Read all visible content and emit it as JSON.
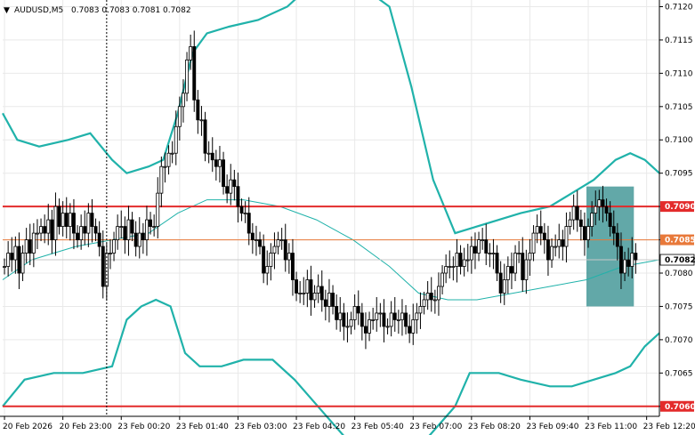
{
  "window": {
    "title": "AUDUSD,M5",
    "ohlc": "0.7083 0.7083 0.7081 0.7082",
    "collapse_glyph": "▼"
  },
  "colors": {
    "background": "#ffffff",
    "candle": "#000000",
    "bollinger_outer": "#20b2aa",
    "bollinger_middle": "#20b2aa",
    "level_main": "#e32b2b",
    "level_secondary": "#e8793a",
    "box_fill": "#2e8b8b",
    "label_bg_red": "#e32b2b",
    "label_bg_orange": "#e8793a",
    "current_label_bg": "#ffffff",
    "grid": "#e9e9e9",
    "divider": "#000000"
  },
  "chart_data": {
    "type": "candlestick",
    "symbol": "AUDUSD",
    "timeframe": "M5",
    "ylim": [
      0.70585,
      0.7121
    ],
    "y_ticks": [
      "0.7120",
      "0.7115",
      "0.7110",
      "0.7105",
      "0.7100",
      "0.7095",
      "0.7090",
      "0.7085",
      "0.7080",
      "0.7075",
      "0.7070",
      "0.7065",
      "0.7060"
    ],
    "y_tick_values": [
      0.712,
      0.7115,
      0.711,
      0.7105,
      0.71,
      0.7095,
      0.709,
      0.7085,
      0.708,
      0.7075,
      0.707,
      0.7065,
      0.706
    ],
    "x_ticks": [
      "20 Feb 2026",
      "20 Feb 23:00",
      "23 Feb 00:20",
      "23 Feb 01:40",
      "23 Feb 03:00",
      "23 Feb 04:20",
      "23 Feb 05:40",
      "23 Feb 07:00",
      "23 Feb 08:20",
      "23 Feb 09:40",
      "23 Feb 11:00",
      "23 Feb 12:20"
    ],
    "x_tick_index": [
      0,
      16,
      32,
      48,
      64,
      80,
      96,
      112,
      128,
      144,
      160,
      176
    ],
    "bar_count": 180,
    "candles_close": [
      0.7081,
      0.7083,
      0.7082,
      0.7084,
      0.708,
      0.7083,
      0.7085,
      0.7083,
      0.7086,
      0.7086,
      0.7087,
      0.7086,
      0.7088,
      0.7085,
      0.709,
      0.7087,
      0.7089,
      0.7087,
      0.7089,
      0.7086,
      0.7085,
      0.7087,
      0.7086,
      0.7089,
      0.7087,
      0.7086,
      0.7084,
      0.7078,
      0.7083,
      0.7083,
      0.7085,
      0.7087,
      0.7087,
      0.7085,
      0.7088,
      0.7086,
      0.7084,
      0.7086,
      0.7085,
      0.7088,
      0.7087,
      0.7087,
      0.7092,
      0.7096,
      0.7096,
      0.7098,
      0.7098,
      0.7102,
      0.7105,
      0.7107,
      0.7112,
      0.7114,
      0.7106,
      0.7103,
      0.7103,
      0.7098,
      0.7098,
      0.7097,
      0.7096,
      0.7097,
      0.7093,
      0.7092,
      0.7094,
      0.7093,
      0.709,
      0.7089,
      0.7089,
      0.7086,
      0.7085,
      0.7085,
      0.7084,
      0.708,
      0.7081,
      0.7083,
      0.7084,
      0.7085,
      0.7085,
      0.7082,
      0.7083,
      0.7079,
      0.7077,
      0.7077,
      0.7077,
      0.7079,
      0.7076,
      0.7077,
      0.7078,
      0.7076,
      0.7075,
      0.7077,
      0.7075,
      0.7073,
      0.7074,
      0.7072,
      0.7072,
      0.7073,
      0.7075,
      0.7074,
      0.7072,
      0.7071,
      0.7073,
      0.7073,
      0.7074,
      0.7074,
      0.7072,
      0.7072,
      0.7074,
      0.7073,
      0.7073,
      0.7074,
      0.7072,
      0.7071,
      0.7073,
      0.7074,
      0.7075,
      0.7076,
      0.7077,
      0.7076,
      0.7076,
      0.7078,
      0.708,
      0.7081,
      0.7081,
      0.7081,
      0.7083,
      0.7081,
      0.7082,
      0.7082,
      0.7084,
      0.7083,
      0.7085,
      0.7085,
      0.7083,
      0.7083,
      0.7083,
      0.708,
      0.7077,
      0.7079,
      0.7081,
      0.708,
      0.7083,
      0.7083,
      0.7079,
      0.7082,
      0.7083,
      0.7086,
      0.7087,
      0.7086,
      0.7085,
      0.7082,
      0.7084,
      0.7084,
      0.7085,
      0.7084,
      0.7087,
      0.7088,
      0.709,
      0.7088,
      0.7087,
      0.7085,
      0.7087,
      0.7089,
      0.709,
      0.7091,
      0.709,
      0.7089,
      0.7087,
      0.7086,
      0.7084,
      0.708,
      0.7082,
      0.7081,
      0.7083,
      0.7082
    ],
    "bollinger_upper_points": [
      [
        0,
        0.7104
      ],
      [
        4,
        0.71
      ],
      [
        10,
        0.7099
      ],
      [
        18,
        0.71
      ],
      [
        24,
        0.7101
      ],
      [
        30,
        0.7097
      ],
      [
        34,
        0.7095
      ],
      [
        40,
        0.7096
      ],
      [
        44,
        0.7097
      ],
      [
        48,
        0.7104
      ],
      [
        52,
        0.7113
      ],
      [
        56,
        0.7116
      ],
      [
        62,
        0.7117
      ],
      [
        70,
        0.7118
      ],
      [
        78,
        0.712
      ],
      [
        84,
        0.7123
      ],
      [
        96,
        0.7124
      ],
      [
        106,
        0.712
      ],
      [
        112,
        0.7108
      ],
      [
        118,
        0.7094
      ],
      [
        124,
        0.7086
      ],
      [
        130,
        0.7087
      ],
      [
        136,
        0.7088
      ],
      [
        142,
        0.7089
      ],
      [
        150,
        0.709
      ],
      [
        156,
        0.7092
      ],
      [
        162,
        0.7094
      ],
      [
        168,
        0.7097
      ],
      [
        172,
        0.7098
      ],
      [
        176,
        0.7097
      ],
      [
        180,
        0.7095
      ]
    ],
    "bollinger_middle_points": [
      [
        0,
        0.7079
      ],
      [
        8,
        0.7082
      ],
      [
        20,
        0.7084
      ],
      [
        30,
        0.7085
      ],
      [
        40,
        0.7086
      ],
      [
        48,
        0.7089
      ],
      [
        56,
        0.7091
      ],
      [
        66,
        0.7091
      ],
      [
        76,
        0.709
      ],
      [
        86,
        0.7088
      ],
      [
        96,
        0.7085
      ],
      [
        106,
        0.7081
      ],
      [
        114,
        0.7077
      ],
      [
        122,
        0.7076
      ],
      [
        130,
        0.7076
      ],
      [
        140,
        0.7077
      ],
      [
        150,
        0.7078
      ],
      [
        160,
        0.7079
      ],
      [
        170,
        0.7081
      ],
      [
        180,
        0.7082
      ]
    ],
    "bollinger_lower_points": [
      [
        0,
        0.706
      ],
      [
        6,
        0.7064
      ],
      [
        14,
        0.7065
      ],
      [
        22,
        0.7065
      ],
      [
        30,
        0.7066
      ],
      [
        34,
        0.7073
      ],
      [
        38,
        0.7075
      ],
      [
        42,
        0.7076
      ],
      [
        46,
        0.7075
      ],
      [
        50,
        0.7068
      ],
      [
        54,
        0.7066
      ],
      [
        60,
        0.7066
      ],
      [
        66,
        0.7067
      ],
      [
        74,
        0.7067
      ],
      [
        80,
        0.7064
      ],
      [
        88,
        0.7059
      ],
      [
        96,
        0.7054
      ],
      [
        106,
        0.7054
      ],
      [
        116,
        0.7055
      ],
      [
        124,
        0.706
      ],
      [
        128,
        0.7065
      ],
      [
        136,
        0.7065
      ],
      [
        142,
        0.7064
      ],
      [
        150,
        0.7063
      ],
      [
        156,
        0.7063
      ],
      [
        162,
        0.7064
      ],
      [
        168,
        0.7065
      ],
      [
        172,
        0.7066
      ],
      [
        176,
        0.7069
      ],
      [
        180,
        0.7071
      ]
    ],
    "horizontal_levels": [
      {
        "value": 0.709,
        "label": "0.7090",
        "style": "main"
      },
      {
        "value": 0.7085,
        "label": "0.7085",
        "style": "secondary"
      },
      {
        "value": 0.706,
        "label": "0.7060",
        "style": "main"
      }
    ],
    "current_price": {
      "value": 0.7082,
      "label": "0.7082"
    },
    "box": {
      "from_index": 160,
      "to_index": 172,
      "top": 0.7093,
      "bottom": 0.7075
    },
    "vertical_divider_index": 28
  }
}
